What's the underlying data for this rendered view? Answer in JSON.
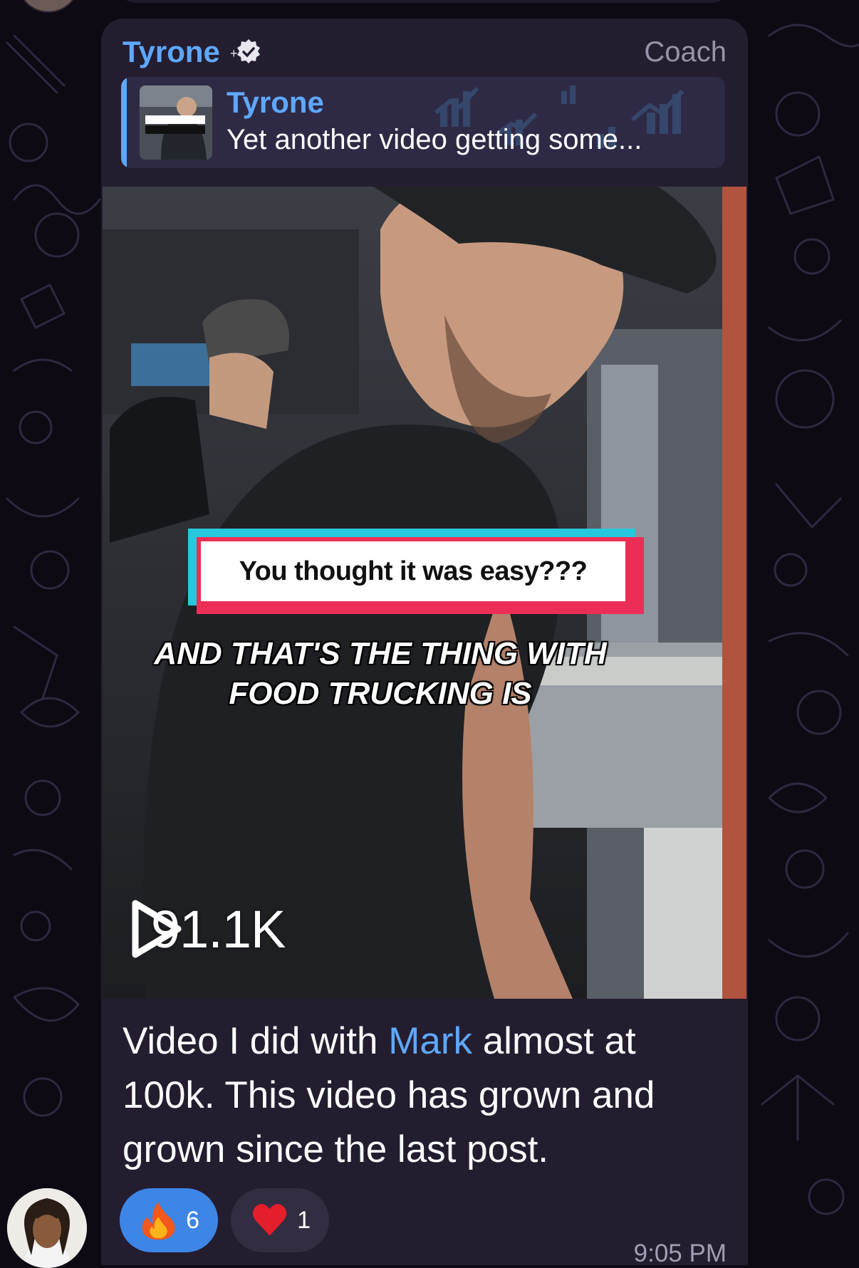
{
  "message": {
    "sender": "Tyrone",
    "role": "Coach",
    "reply": {
      "name": "Tyrone",
      "text": "Yet another video getting some..."
    },
    "media": {
      "caption": "You thought it was easy???",
      "overlay_line1": "AND THAT'S THE THING WITH",
      "overlay_line2": "FOOD TRUCKING IS",
      "views": "91.1K"
    },
    "text": {
      "before": "Video I did with ",
      "mention": "Mark",
      "after": " almost at 100k. This video has grown and grown since the last post."
    },
    "reactions": [
      {
        "emoji": "fire-icon",
        "count": "6"
      },
      {
        "emoji": "heart-icon",
        "count": "1"
      }
    ],
    "time": "9:05 PM"
  },
  "colors": {
    "accent": "#5ea8ff",
    "bubble": "#241d30",
    "reaction_active": "#3d86e6"
  }
}
